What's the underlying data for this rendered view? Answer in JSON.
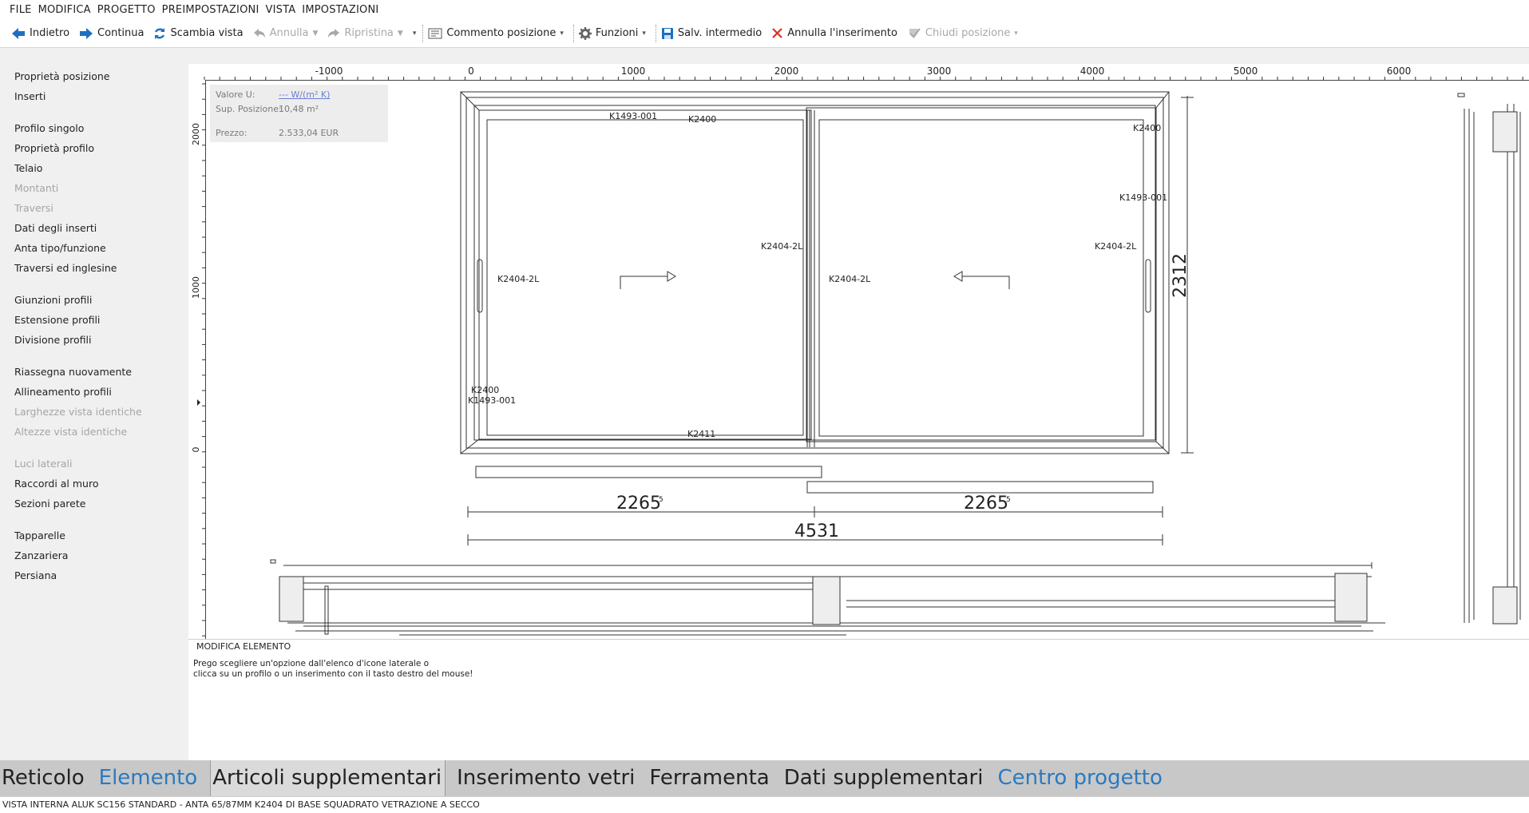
{
  "menu": [
    "FILE",
    "MODIFICA",
    "PROGETTO",
    "PREIMPOSTAZIONI",
    "VISTA",
    "IMPOSTAZIONI"
  ],
  "toolbar": {
    "back": "Indietro",
    "next": "Continua",
    "swap_view": "Scambia vista",
    "undo": "Annulla",
    "redo": "Ripristina",
    "comment": "Commento posizione",
    "functions": "Funzioni",
    "save": "Salv. intermedio",
    "cancel_insert": "Annulla l'inserimento",
    "close_position": "Chiudi posizione"
  },
  "sidebar": {
    "groups": [
      [
        {
          "label": "Proprietà posizione",
          "enabled": true
        },
        {
          "label": "Inserti",
          "enabled": true
        }
      ],
      [
        {
          "label": "Profilo singolo",
          "enabled": true
        },
        {
          "label": "Proprietà profilo",
          "enabled": true
        },
        {
          "label": "Telaio",
          "enabled": true
        },
        {
          "label": "Montanti",
          "enabled": false
        },
        {
          "label": "Traversi",
          "enabled": false
        },
        {
          "label": "Dati degli inserti",
          "enabled": true
        },
        {
          "label": "Anta tipo/funzione",
          "enabled": true
        },
        {
          "label": "Traversi ed inglesine",
          "enabled": true
        }
      ],
      [
        {
          "label": "Giunzioni profili",
          "enabled": true
        },
        {
          "label": "Estensione profili",
          "enabled": true
        },
        {
          "label": "Divisione profili",
          "enabled": true
        }
      ],
      [
        {
          "label": "Riassegna nuovamente",
          "enabled": true
        },
        {
          "label": "Allineamento profili",
          "enabled": true
        },
        {
          "label": "Larghezze vista identiche",
          "enabled": false
        },
        {
          "label": "Altezze vista identiche",
          "enabled": false
        }
      ],
      [
        {
          "label": "Luci laterali",
          "enabled": false
        },
        {
          "label": "Raccordi al muro",
          "enabled": true
        },
        {
          "label": "Sezioni parete",
          "enabled": true
        }
      ],
      [
        {
          "label": "Tapparelle",
          "enabled": true
        },
        {
          "label": "Zanzariera",
          "enabled": true
        },
        {
          "label": "Persiana",
          "enabled": true
        }
      ]
    ]
  },
  "ruler": {
    "h_labels": [
      "-1000",
      "0",
      "1000",
      "2000",
      "3000",
      "4000",
      "5000",
      "6000"
    ],
    "v_labels": [
      "2000",
      "1000",
      "0"
    ]
  },
  "info": {
    "u_label": "Valore U:",
    "u_value": "--- W/(m² K)",
    "area_label": "Sup. Posizione:",
    "area_value": "10,48 m²",
    "price_label": "Prezzo:",
    "price_value": "2.533,04 EUR"
  },
  "drawing": {
    "profile_labels": {
      "top_left": "K1493-001",
      "top_center": "K2400",
      "top_right": "K2400",
      "right_upper": "K1493-001",
      "mullion_left": "K2404-2L",
      "right_sash": "K2404-2L",
      "left_sash": "K2404-2L",
      "mullion_right": "K2404-2L",
      "bottom_left_1": "K2400",
      "bottom_left_2": "K1493-001",
      "bottom": "K2411"
    },
    "height_dim": "2312",
    "left_width_main": "2265",
    "left_width_sup": "5",
    "right_width_main": "2265",
    "right_width_sup": "5",
    "total_width": "4531"
  },
  "message": {
    "title": "MODIFICA ELEMENTO",
    "line1": "Prego scegliere un'opzione dall'elenco d'icone laterale o",
    "line2": "clicca su un profilo o un inserimento con il tasto destro del mouse!"
  },
  "tabs": [
    {
      "label": "Reticolo",
      "style": "normal"
    },
    {
      "label": "Elemento",
      "style": "blue"
    },
    {
      "label": "Articoli supplementari",
      "style": "active"
    },
    {
      "label": "Inserimento vetri",
      "style": "normal"
    },
    {
      "label": "Ferramenta",
      "style": "normal"
    },
    {
      "label": "Dati supplementari",
      "style": "normal"
    },
    {
      "label": "Centro progetto",
      "style": "blue"
    }
  ],
  "status": "VISTA INTERNA    ALUK SC156 STANDARD - ANTA 65/87MM K2404 DI BASE SQUADRATO VETRAZIONE A SECCO",
  "colors": {
    "accent_blue": "#2a7ac0",
    "toolbar_blue": "#1e6fc0",
    "cancel_red": "#d9302a"
  }
}
